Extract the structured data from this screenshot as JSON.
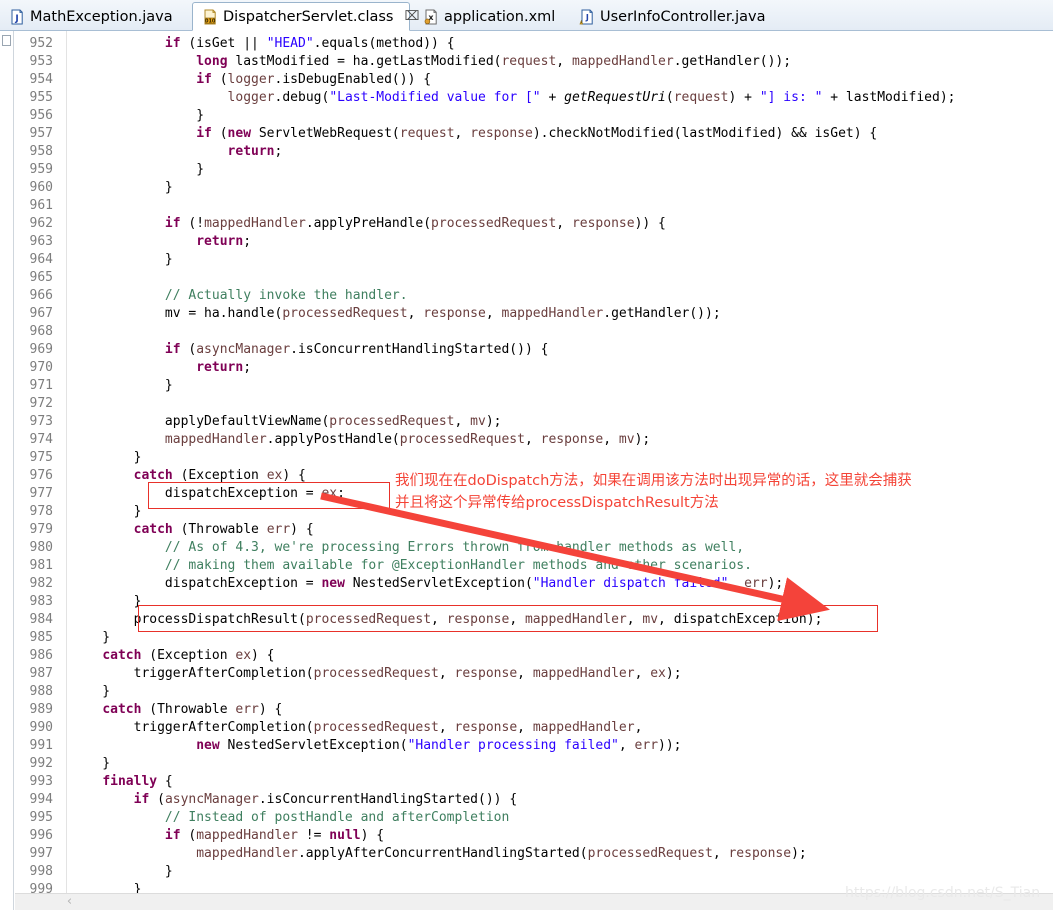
{
  "window": {
    "watermark": "https://blog.csdn.net/S_Tian"
  },
  "tabbar": {
    "tabs": [
      {
        "label": "MathException.java",
        "icon": "java-file-icon",
        "active": false,
        "closable": false,
        "warning": false
      },
      {
        "label": "DispatcherServlet.class",
        "icon": "class-file-icon",
        "active": true,
        "closable": true,
        "close_glyph": "⌧",
        "warning": false
      },
      {
        "label": "application.xml",
        "icon": "xml-file-icon",
        "active": false,
        "closable": false,
        "warning": false
      },
      {
        "label": "UserInfoController.java",
        "icon": "java-file-warning-icon",
        "active": false,
        "closable": false,
        "warning": true
      }
    ]
  },
  "editor": {
    "first_line": 952,
    "scrollbar": {
      "left_arrow_glyph": "‹"
    },
    "lines": [
      {
        "n": "952",
        "tokens": [
          {
            "t": "            ",
            "c": "pln"
          },
          {
            "t": "if",
            "c": "kw"
          },
          {
            "t": " (isGet ",
            "c": "pln"
          },
          {
            "t": "||",
            "c": "pln"
          },
          {
            "t": " ",
            "c": "pln"
          },
          {
            "t": "\"HEAD\"",
            "c": "str"
          },
          {
            "t": ".equals(method)) {",
            "c": "pln"
          }
        ]
      },
      {
        "n": "953",
        "tokens": [
          {
            "t": "                ",
            "c": "pln"
          },
          {
            "t": "long",
            "c": "kw"
          },
          {
            "t": " lastModified = ha.getLastModified(",
            "c": "pln"
          },
          {
            "t": "request",
            "c": "par"
          },
          {
            "t": ", ",
            "c": "pln"
          },
          {
            "t": "mappedHandler",
            "c": "par"
          },
          {
            "t": ".getHandler());",
            "c": "pln"
          }
        ]
      },
      {
        "n": "954",
        "tokens": [
          {
            "t": "                ",
            "c": "pln"
          },
          {
            "t": "if",
            "c": "kw"
          },
          {
            "t": " (",
            "c": "pln"
          },
          {
            "t": "logger",
            "c": "par"
          },
          {
            "t": ".isDebugEnabled()) {",
            "c": "pln"
          }
        ]
      },
      {
        "n": "955",
        "tokens": [
          {
            "t": "                    ",
            "c": "pln"
          },
          {
            "t": "logger",
            "c": "par"
          },
          {
            "t": ".debug(",
            "c": "pln"
          },
          {
            "t": "\"Last-Modified value for [\"",
            "c": "str"
          },
          {
            "t": " + ",
            "c": "pln"
          },
          {
            "t": "getRequestUri",
            "c": "stat"
          },
          {
            "t": "(",
            "c": "pln"
          },
          {
            "t": "request",
            "c": "par"
          },
          {
            "t": ") + ",
            "c": "pln"
          },
          {
            "t": "\"] is: \"",
            "c": "str"
          },
          {
            "t": " + lastModified);",
            "c": "pln"
          }
        ]
      },
      {
        "n": "956",
        "tokens": [
          {
            "t": "                }",
            "c": "pln"
          }
        ]
      },
      {
        "n": "957",
        "tokens": [
          {
            "t": "                ",
            "c": "pln"
          },
          {
            "t": "if",
            "c": "kw"
          },
          {
            "t": " (",
            "c": "pln"
          },
          {
            "t": "new",
            "c": "kw"
          },
          {
            "t": " ServletWebRequest(",
            "c": "pln"
          },
          {
            "t": "request",
            "c": "par"
          },
          {
            "t": ", ",
            "c": "pln"
          },
          {
            "t": "response",
            "c": "par"
          },
          {
            "t": ").checkNotModified(lastModified) && isGet) {",
            "c": "pln"
          }
        ]
      },
      {
        "n": "958",
        "tokens": [
          {
            "t": "                    ",
            "c": "pln"
          },
          {
            "t": "return",
            "c": "kw"
          },
          {
            "t": ";",
            "c": "pln"
          }
        ]
      },
      {
        "n": "959",
        "tokens": [
          {
            "t": "                }",
            "c": "pln"
          }
        ]
      },
      {
        "n": "960",
        "tokens": [
          {
            "t": "            }",
            "c": "pln"
          }
        ]
      },
      {
        "n": "961",
        "tokens": [
          {
            "t": "",
            "c": "pln"
          }
        ]
      },
      {
        "n": "962",
        "tokens": [
          {
            "t": "            ",
            "c": "pln"
          },
          {
            "t": "if",
            "c": "kw"
          },
          {
            "t": " (!",
            "c": "pln"
          },
          {
            "t": "mappedHandler",
            "c": "par"
          },
          {
            "t": ".applyPreHandle(",
            "c": "pln"
          },
          {
            "t": "processedRequest",
            "c": "par"
          },
          {
            "t": ", ",
            "c": "pln"
          },
          {
            "t": "response",
            "c": "par"
          },
          {
            "t": ")) {",
            "c": "pln"
          }
        ]
      },
      {
        "n": "963",
        "tokens": [
          {
            "t": "                ",
            "c": "pln"
          },
          {
            "t": "return",
            "c": "kw"
          },
          {
            "t": ";",
            "c": "pln"
          }
        ]
      },
      {
        "n": "964",
        "tokens": [
          {
            "t": "            }",
            "c": "pln"
          }
        ]
      },
      {
        "n": "965",
        "tokens": [
          {
            "t": "",
            "c": "pln"
          }
        ]
      },
      {
        "n": "966",
        "tokens": [
          {
            "t": "            ",
            "c": "pln"
          },
          {
            "t": "// Actually invoke the handler.",
            "c": "cmt"
          }
        ]
      },
      {
        "n": "967",
        "tokens": [
          {
            "t": "            mv = ha.handle(",
            "c": "pln"
          },
          {
            "t": "processedRequest",
            "c": "par"
          },
          {
            "t": ", ",
            "c": "pln"
          },
          {
            "t": "response",
            "c": "par"
          },
          {
            "t": ", ",
            "c": "pln"
          },
          {
            "t": "mappedHandler",
            "c": "par"
          },
          {
            "t": ".getHandler());",
            "c": "pln"
          }
        ]
      },
      {
        "n": "968",
        "tokens": [
          {
            "t": "",
            "c": "pln"
          }
        ]
      },
      {
        "n": "969",
        "tokens": [
          {
            "t": "            ",
            "c": "pln"
          },
          {
            "t": "if",
            "c": "kw"
          },
          {
            "t": " (",
            "c": "pln"
          },
          {
            "t": "asyncManager",
            "c": "par"
          },
          {
            "t": ".isConcurrentHandlingStarted()) {",
            "c": "pln"
          }
        ]
      },
      {
        "n": "970",
        "tokens": [
          {
            "t": "                ",
            "c": "pln"
          },
          {
            "t": "return",
            "c": "kw"
          },
          {
            "t": ";",
            "c": "pln"
          }
        ]
      },
      {
        "n": "971",
        "tokens": [
          {
            "t": "            }",
            "c": "pln"
          }
        ]
      },
      {
        "n": "972",
        "tokens": [
          {
            "t": "",
            "c": "pln"
          }
        ]
      },
      {
        "n": "973",
        "tokens": [
          {
            "t": "            applyDefaultViewName(",
            "c": "pln"
          },
          {
            "t": "processedRequest",
            "c": "par"
          },
          {
            "t": ", ",
            "c": "pln"
          },
          {
            "t": "mv",
            "c": "par"
          },
          {
            "t": ");",
            "c": "pln"
          }
        ]
      },
      {
        "n": "974",
        "tokens": [
          {
            "t": "            ",
            "c": "pln"
          },
          {
            "t": "mappedHandler",
            "c": "par"
          },
          {
            "t": ".applyPostHandle(",
            "c": "pln"
          },
          {
            "t": "processedRequest",
            "c": "par"
          },
          {
            "t": ", ",
            "c": "pln"
          },
          {
            "t": "response",
            "c": "par"
          },
          {
            "t": ", ",
            "c": "pln"
          },
          {
            "t": "mv",
            "c": "par"
          },
          {
            "t": ");",
            "c": "pln"
          }
        ]
      },
      {
        "n": "975",
        "tokens": [
          {
            "t": "        }",
            "c": "pln"
          }
        ]
      },
      {
        "n": "976",
        "tokens": [
          {
            "t": "        ",
            "c": "pln"
          },
          {
            "t": "catch",
            "c": "kw"
          },
          {
            "t": " (Exception ",
            "c": "pln"
          },
          {
            "t": "ex",
            "c": "par"
          },
          {
            "t": ") {",
            "c": "pln"
          }
        ]
      },
      {
        "n": "977",
        "tokens": [
          {
            "t": "            dispatchException = ",
            "c": "pln"
          },
          {
            "t": "ex",
            "c": "par"
          },
          {
            "t": ";",
            "c": "pln"
          }
        ]
      },
      {
        "n": "978",
        "tokens": [
          {
            "t": "        }",
            "c": "pln"
          }
        ]
      },
      {
        "n": "979",
        "tokens": [
          {
            "t": "        ",
            "c": "pln"
          },
          {
            "t": "catch",
            "c": "kw"
          },
          {
            "t": " (Throwable ",
            "c": "pln"
          },
          {
            "t": "err",
            "c": "par"
          },
          {
            "t": ") {",
            "c": "pln"
          }
        ]
      },
      {
        "n": "980",
        "tokens": [
          {
            "t": "            ",
            "c": "pln"
          },
          {
            "t": "// As of 4.3, we're processing Errors thrown from handler methods as well,",
            "c": "cmt"
          }
        ]
      },
      {
        "n": "981",
        "tokens": [
          {
            "t": "            ",
            "c": "pln"
          },
          {
            "t": "// making them available for @ExceptionHandler methods and other scenarios.",
            "c": "cmt"
          }
        ]
      },
      {
        "n": "982",
        "tokens": [
          {
            "t": "            dispatchException = ",
            "c": "pln"
          },
          {
            "t": "new",
            "c": "kw"
          },
          {
            "t": " NestedServletException(",
            "c": "pln"
          },
          {
            "t": "\"Handler dispatch failed\"",
            "c": "str"
          },
          {
            "t": ", ",
            "c": "pln"
          },
          {
            "t": "err",
            "c": "par"
          },
          {
            "t": ");",
            "c": "pln"
          }
        ]
      },
      {
        "n": "983",
        "tokens": [
          {
            "t": "        }",
            "c": "pln"
          }
        ]
      },
      {
        "n": "984",
        "tokens": [
          {
            "t": "        processDispatchResult(",
            "c": "pln"
          },
          {
            "t": "processedRequest",
            "c": "par"
          },
          {
            "t": ", ",
            "c": "pln"
          },
          {
            "t": "response",
            "c": "par"
          },
          {
            "t": ", ",
            "c": "pln"
          },
          {
            "t": "mappedHandler",
            "c": "par"
          },
          {
            "t": ", ",
            "c": "pln"
          },
          {
            "t": "mv",
            "c": "par"
          },
          {
            "t": ", dispatchException);",
            "c": "pln"
          }
        ]
      },
      {
        "n": "985",
        "tokens": [
          {
            "t": "    }",
            "c": "pln"
          }
        ]
      },
      {
        "n": "986",
        "tokens": [
          {
            "t": "    ",
            "c": "pln"
          },
          {
            "t": "catch",
            "c": "kw"
          },
          {
            "t": " (Exception ",
            "c": "pln"
          },
          {
            "t": "ex",
            "c": "par"
          },
          {
            "t": ") {",
            "c": "pln"
          }
        ]
      },
      {
        "n": "987",
        "tokens": [
          {
            "t": "        triggerAfterCompletion(",
            "c": "pln"
          },
          {
            "t": "processedRequest",
            "c": "par"
          },
          {
            "t": ", ",
            "c": "pln"
          },
          {
            "t": "response",
            "c": "par"
          },
          {
            "t": ", ",
            "c": "pln"
          },
          {
            "t": "mappedHandler",
            "c": "par"
          },
          {
            "t": ", ",
            "c": "pln"
          },
          {
            "t": "ex",
            "c": "par"
          },
          {
            "t": ");",
            "c": "pln"
          }
        ]
      },
      {
        "n": "988",
        "tokens": [
          {
            "t": "    }",
            "c": "pln"
          }
        ]
      },
      {
        "n": "989",
        "tokens": [
          {
            "t": "    ",
            "c": "pln"
          },
          {
            "t": "catch",
            "c": "kw"
          },
          {
            "t": " (Throwable ",
            "c": "pln"
          },
          {
            "t": "err",
            "c": "par"
          },
          {
            "t": ") {",
            "c": "pln"
          }
        ]
      },
      {
        "n": "990",
        "tokens": [
          {
            "t": "        triggerAfterCompletion(",
            "c": "pln"
          },
          {
            "t": "processedRequest",
            "c": "par"
          },
          {
            "t": ", ",
            "c": "pln"
          },
          {
            "t": "response",
            "c": "par"
          },
          {
            "t": ", ",
            "c": "pln"
          },
          {
            "t": "mappedHandler",
            "c": "par"
          },
          {
            "t": ",",
            "c": "pln"
          }
        ]
      },
      {
        "n": "991",
        "tokens": [
          {
            "t": "                ",
            "c": "pln"
          },
          {
            "t": "new",
            "c": "kw"
          },
          {
            "t": " NestedServletException(",
            "c": "pln"
          },
          {
            "t": "\"Handler processing failed\"",
            "c": "str"
          },
          {
            "t": ", ",
            "c": "pln"
          },
          {
            "t": "err",
            "c": "par"
          },
          {
            "t": "));",
            "c": "pln"
          }
        ]
      },
      {
        "n": "992",
        "tokens": [
          {
            "t": "    }",
            "c": "pln"
          }
        ]
      },
      {
        "n": "993",
        "tokens": [
          {
            "t": "    ",
            "c": "pln"
          },
          {
            "t": "finally",
            "c": "kw"
          },
          {
            "t": " {",
            "c": "pln"
          }
        ]
      },
      {
        "n": "994",
        "tokens": [
          {
            "t": "        ",
            "c": "pln"
          },
          {
            "t": "if",
            "c": "kw"
          },
          {
            "t": " (",
            "c": "pln"
          },
          {
            "t": "asyncManager",
            "c": "par"
          },
          {
            "t": ".isConcurrentHandlingStarted()) {",
            "c": "pln"
          }
        ]
      },
      {
        "n": "995",
        "tokens": [
          {
            "t": "            ",
            "c": "pln"
          },
          {
            "t": "// Instead of postHandle and afterCompletion",
            "c": "cmt"
          }
        ]
      },
      {
        "n": "996",
        "tokens": [
          {
            "t": "            ",
            "c": "pln"
          },
          {
            "t": "if",
            "c": "kw"
          },
          {
            "t": " (",
            "c": "pln"
          },
          {
            "t": "mappedHandler",
            "c": "par"
          },
          {
            "t": " != ",
            "c": "pln"
          },
          {
            "t": "null",
            "c": "kw"
          },
          {
            "t": ") {",
            "c": "pln"
          }
        ]
      },
      {
        "n": "997",
        "tokens": [
          {
            "t": "                ",
            "c": "pln"
          },
          {
            "t": "mappedHandler",
            "c": "par"
          },
          {
            "t": ".applyAfterConcurrentHandlingStarted(",
            "c": "pln"
          },
          {
            "t": "processedRequest",
            "c": "par"
          },
          {
            "t": ", ",
            "c": "pln"
          },
          {
            "t": "response",
            "c": "par"
          },
          {
            "t": ");",
            "c": "pln"
          }
        ]
      },
      {
        "n": "998",
        "tokens": [
          {
            "t": "            }",
            "c": "pln"
          }
        ]
      },
      {
        "n": "999",
        "tokens": [
          {
            "t": "        }",
            "c": "pln"
          }
        ]
      }
    ]
  },
  "annotations": {
    "accent_color": "#f44336",
    "highlight_box_color": "#e8312a",
    "note_line1": "我们现在在doDispatch方法，如果在调用该方法时出现异常的话，这里就会捕获",
    "note_line2": "并且将这个异常传给processDispatchResult方法",
    "boxes": [
      {
        "name": "dispatch-exception-assign-box",
        "targets_line": "977"
      },
      {
        "name": "process-dispatch-result-box",
        "targets_line": "984"
      }
    ],
    "arrow": {
      "name": "annotation-arrow",
      "from_line": "977",
      "to_line": "984"
    }
  }
}
